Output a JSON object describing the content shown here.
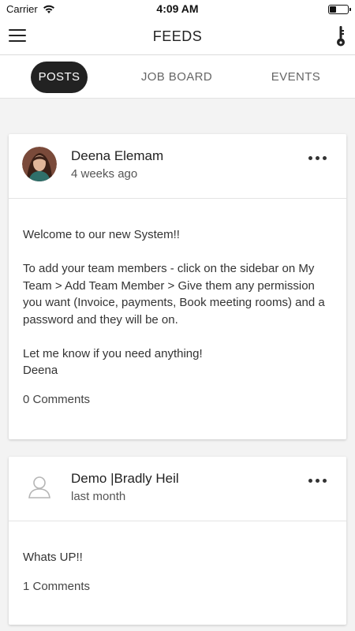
{
  "status_bar": {
    "carrier": "Carrier",
    "time": "4:09 AM"
  },
  "header": {
    "title": "FEEDS",
    "menu_icon": "hamburger-menu-icon",
    "right_icon": "key-icon"
  },
  "tabs": [
    {
      "label": "POSTS",
      "active": true
    },
    {
      "label": "JOB BOARD",
      "active": false
    },
    {
      "label": "EVENTS",
      "active": false
    }
  ],
  "posts": [
    {
      "author": "Deena Elemam",
      "time_ago": "4 weeks ago",
      "avatar": "photo",
      "paragraphs": [
        "Welcome to our new System!!",
        "To add your team members - click on the sidebar on My Team > Add Team Member > Give them any permission you want (Invoice, payments, Book meeting rooms) and a password and they will be on.",
        "Let me know if you need anything!",
        "Deena"
      ],
      "comments": "0 Comments"
    },
    {
      "author": "Demo |Bradly Heil",
      "time_ago": "last month",
      "avatar": "placeholder-user-icon",
      "paragraphs": [
        "Whats UP!!"
      ],
      "comments": "1 Comments"
    }
  ],
  "colors": {
    "active_tab_bg": "#222222",
    "page_bg": "#f3f3f3",
    "card_bg": "#ffffff"
  }
}
